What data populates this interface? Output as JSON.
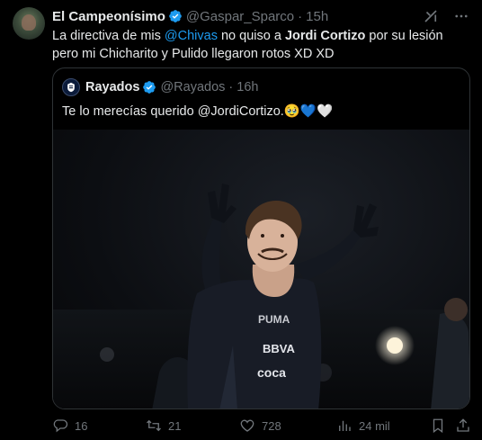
{
  "tweet": {
    "author_name": "El Campeonísimo",
    "handle": "@Gaspar_Sparco",
    "separator": "·",
    "time": "15h",
    "text_part1": "La directiva de mis ",
    "mention": "@Chivas",
    "text_part2": " no quiso a ",
    "bold_name": "Jordi Cortizo",
    "text_part3": " por su lesión pero mi Chicharito y Pulido llegaron rotos XD XD"
  },
  "quote": {
    "author_name": "Rayados",
    "handle": "@Rayados",
    "separator": "·",
    "time": "16h",
    "text": "Te lo merecías querido @JordiCortizo.",
    "emoji_face": "🥹",
    "emoji_heart_blue": "💙",
    "emoji_heart_white": "🤍"
  },
  "actions": {
    "replies": "16",
    "retweets": "21",
    "likes": "728",
    "views": "24 mil"
  },
  "colors": {
    "background": "#000000",
    "text": "#e7e9ea",
    "muted": "#71767b",
    "accent": "#1d9bf0",
    "border": "#2f3336"
  },
  "icons": [
    "verified-badge-icon",
    "grok-icon",
    "more-icon",
    "reply-icon",
    "retweet-icon",
    "like-icon",
    "views-icon",
    "bookmark-icon",
    "share-icon"
  ]
}
